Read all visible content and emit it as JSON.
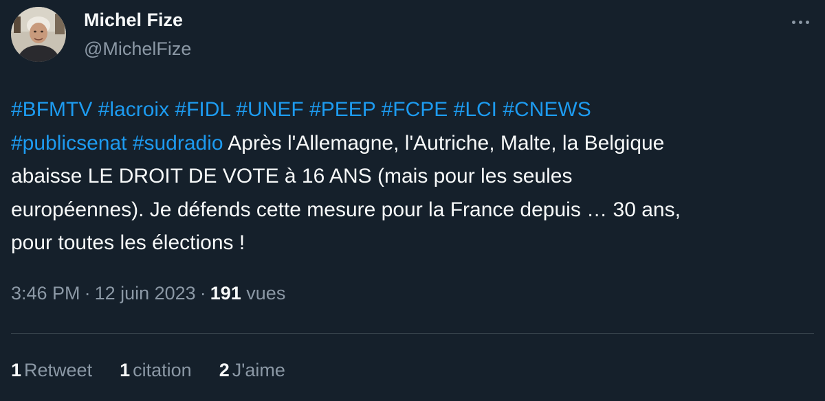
{
  "author": {
    "name": "Michel Fize",
    "handle": "@MichelFize"
  },
  "tweet": {
    "segments": [
      {
        "type": "hashtag",
        "text": "#BFMTV"
      },
      {
        "type": "text",
        "text": " "
      },
      {
        "type": "hashtag",
        "text": "#lacroix"
      },
      {
        "type": "text",
        "text": " "
      },
      {
        "type": "hashtag",
        "text": "#FIDL"
      },
      {
        "type": "text",
        "text": " "
      },
      {
        "type": "hashtag",
        "text": "#UNEF"
      },
      {
        "type": "text",
        "text": " "
      },
      {
        "type": "hashtag",
        "text": "#PEEP"
      },
      {
        "type": "text",
        "text": " "
      },
      {
        "type": "hashtag",
        "text": "#FCPE"
      },
      {
        "type": "text",
        "text": " "
      },
      {
        "type": "hashtag",
        "text": "#LCI"
      },
      {
        "type": "text",
        "text": " "
      },
      {
        "type": "hashtag",
        "text": "#CNEWS"
      },
      {
        "type": "text",
        "text": "\n"
      },
      {
        "type": "hashtag",
        "text": "#publicsenat"
      },
      {
        "type": "text",
        "text": " "
      },
      {
        "type": "hashtag",
        "text": "#sudradio"
      },
      {
        "type": "text",
        "text": " Après l'Allemagne, l'Autriche, Malte, la Belgique\nabaisse LE DROIT DE VOTE à 16 ANS (mais pour les seules\neuropéennes). Je défends cette mesure pour la France depuis … 30 ans,\npour toutes les élections !"
      }
    ]
  },
  "meta": {
    "time": "3:46 PM",
    "separator": "·",
    "date": "12 juin 2023",
    "views_count": "191",
    "views_label": "vues"
  },
  "stats": {
    "retweets": {
      "count": "1",
      "label": "Retweet"
    },
    "quotes": {
      "count": "1",
      "label": "citation"
    },
    "likes": {
      "count": "2",
      "label": "J'aime"
    }
  },
  "icons": {
    "more": "more-horizontal-icon",
    "avatar": "avatar-photo"
  },
  "colors": {
    "background": "#15202b",
    "text": "#f7f9f9",
    "secondary": "#8b98a5",
    "link": "#1d9bf0",
    "divider": "#38444d"
  }
}
